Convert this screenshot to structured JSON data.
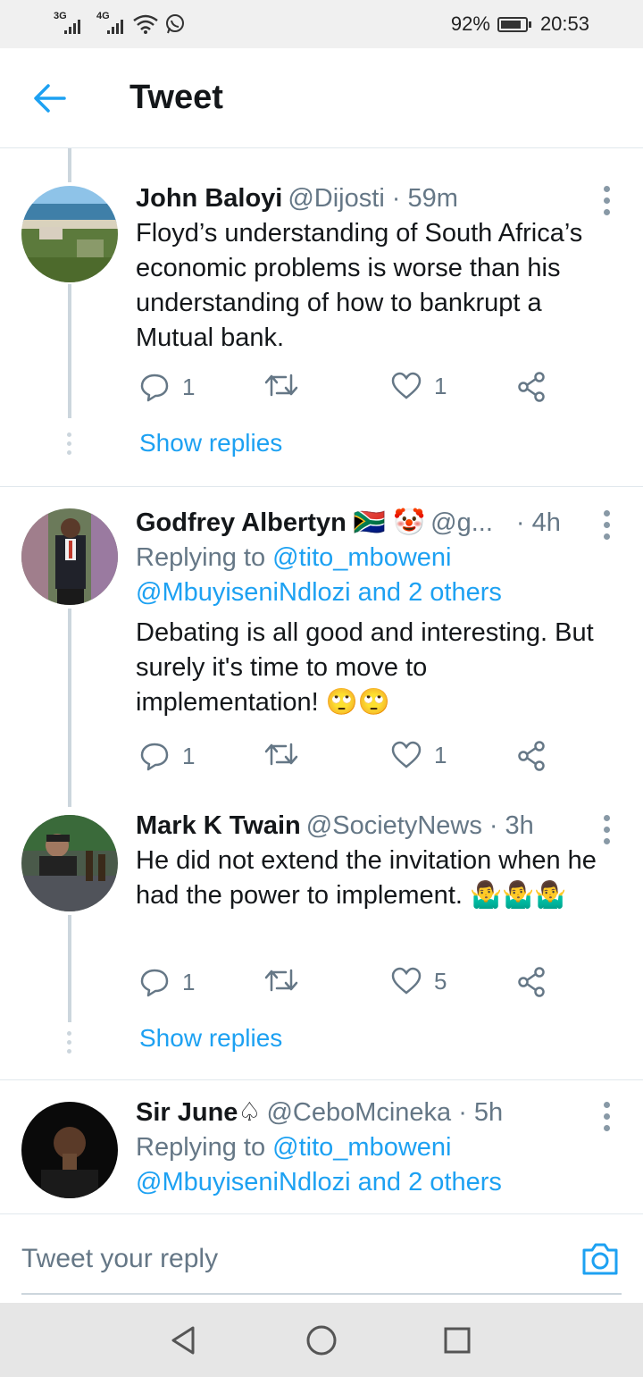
{
  "status_bar": {
    "network_1": "3G",
    "network_2": "4G",
    "battery": "92%",
    "time": "20:53",
    "icons": [
      "signal-icon",
      "signal-icon",
      "wifi-icon",
      "whatsapp-icon",
      "battery-icon"
    ]
  },
  "header": {
    "title": "Tweet",
    "back_icon": "arrow-left-icon",
    "accent": "#1da1f2"
  },
  "tweets": [
    {
      "name": "John Baloyi",
      "handle": "@Dijosti",
      "time": "· 59m",
      "text": "Floyd’s understanding of South Africa’s economic problems is worse than his understanding of how to bankrupt a Mutual bank.",
      "replies": "1",
      "retweets": "",
      "likes": "1",
      "show_replies": "Show replies"
    },
    {
      "name": "Godfrey Albertyn 🇿🇦 🤡",
      "handle": "@g...",
      "time": "· 4h",
      "replying_prefix": "Replying to",
      "replying_links": "@tito_mboweni @MbuyiseniNdlozi and 2 others",
      "text": "Debating is all good and interesting. But surely it's time to move to implementation! 🙄🙄",
      "replies": "1",
      "retweets": "",
      "likes": "1"
    },
    {
      "name": "Mark K Twain",
      "handle": "@SocietyNews",
      "time": "· 3h",
      "text": "He did not extend the invitation when he had the power to implement. 🤷‍♂️🤷‍♂️🤷‍♂️",
      "replies": "1",
      "retweets": "",
      "likes": "5",
      "show_replies": "Show replies"
    },
    {
      "name": "Sir June♤",
      "handle": "@CeboMcineka",
      "time": "· 5h",
      "replying_prefix": "Replying to",
      "replying_links": "@tito_mboweni @MbuyiseniNdlozi and 2 others"
    }
  ],
  "reply_box": {
    "placeholder": "Tweet your reply",
    "camera_icon": "camera-icon"
  },
  "nav_bar": {
    "icons": [
      "back-triangle-icon",
      "home-circle-icon",
      "recents-square-icon"
    ]
  }
}
